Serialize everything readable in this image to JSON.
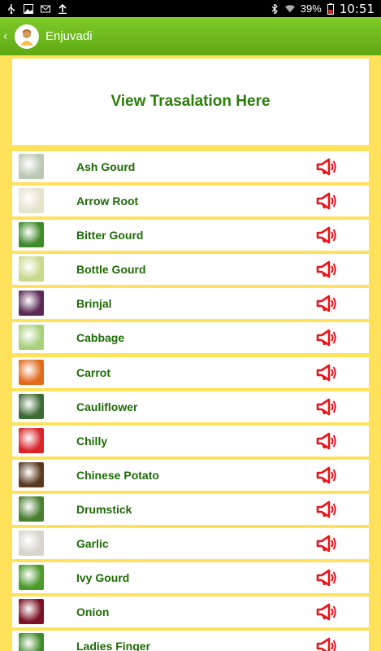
{
  "status_bar": {
    "battery_percent": "39%",
    "time": "10:51"
  },
  "action_bar": {
    "title": "Enjuvadi"
  },
  "banner": {
    "text": "View Trasalation Here"
  },
  "vegetables": [
    {
      "name": "Ash Gourd",
      "color": "#b9c9b4"
    },
    {
      "name": "Arrow Root",
      "color": "#e6e2cc"
    },
    {
      "name": "Bitter Gourd",
      "color": "#3f8a2a"
    },
    {
      "name": "Bottle Gourd",
      "color": "#c7d98a"
    },
    {
      "name": "Brinjal",
      "color": "#5a2a55"
    },
    {
      "name": "Cabbage",
      "color": "#a9d07d"
    },
    {
      "name": "Carrot",
      "color": "#e26a1e"
    },
    {
      "name": "Cauliflower",
      "color": "#3d6a33"
    },
    {
      "name": "Chilly",
      "color": "#d9242a"
    },
    {
      "name": "Chinese Potato",
      "color": "#5b3a22"
    },
    {
      "name": "Drumstick",
      "color": "#4a7f30"
    },
    {
      "name": "Garlic",
      "color": "#d8d4cc"
    },
    {
      "name": "Ivy Gourd",
      "color": "#4c9a2a"
    },
    {
      "name": "Onion",
      "color": "#7a1224"
    },
    {
      "name": "Ladies Finger",
      "color": "#3f8a2a"
    }
  ],
  "colors": {
    "accent_green": "#5ea913",
    "text_green": "#1e6b06",
    "speaker_red": "#e8151b",
    "background_yellow": "#ffe15a"
  }
}
